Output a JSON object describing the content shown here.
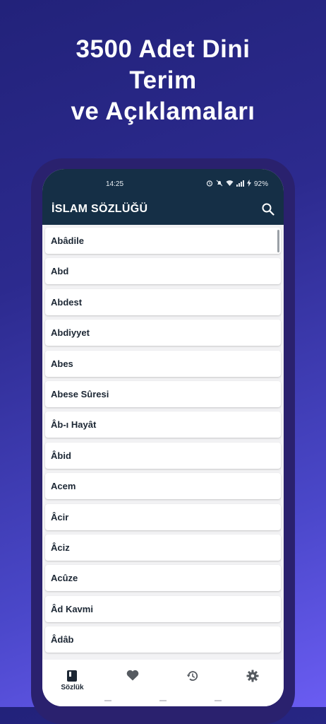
{
  "promo": {
    "headline_lines": [
      "3500 Adet Dini",
      "Terim",
      "ve Açıklamaları"
    ]
  },
  "status_bar": {
    "time": "14:25",
    "battery": "92%"
  },
  "app_bar": {
    "title": "İSLAM SÖZLÜĞÜ",
    "search_icon": "search-icon"
  },
  "terms": [
    "Abâdile",
    "Abd",
    "Abdest",
    "Abdiyyet",
    "Abes",
    "Abese Sûresi",
    "Âb-ı Hayât",
    "Âbid",
    "Acem",
    "Âcir",
    "Âciz",
    "Acûze",
    "Âd Kavmi",
    "Âdâb"
  ],
  "bottom_nav": {
    "items": [
      {
        "icon": "book-icon",
        "label": "Sözlük",
        "selected": true
      },
      {
        "icon": "heart-icon",
        "label": "",
        "selected": false
      },
      {
        "icon": "history-icon",
        "label": "",
        "selected": false
      },
      {
        "icon": "gear-icon",
        "label": "",
        "selected": false
      }
    ]
  },
  "colors": {
    "app_bar": "#152f46",
    "background_gradient_start": "#22227a",
    "background_gradient_end": "#6a5cf2",
    "phone_frame": "#2a216e"
  }
}
